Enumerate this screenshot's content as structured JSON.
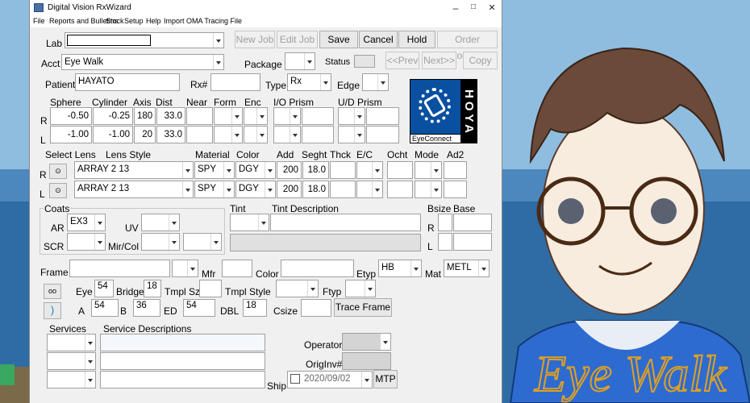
{
  "window": {
    "title": "Digital Vision RxWizard",
    "minimize": "–",
    "maximize": "□",
    "close": "✕"
  },
  "menu": [
    "File",
    "Reports and Bulletins",
    "Stock",
    "Setup",
    "Help",
    "Import OMA Tracing File"
  ],
  "buttons": {
    "new_job": "New Job",
    "edit_job": "Edit Job",
    "save": "Save",
    "cancel": "Cancel",
    "hold": "Hold",
    "order_lookup": "Order Lookup",
    "prev": "<<Prev",
    "next": "Next>>",
    "copy": "Copy",
    "trace_frame": "Trace Frame",
    "mtp": "MTP"
  },
  "labels": {
    "lab": "Lab",
    "acct": "Acct",
    "patient": "Patient",
    "rx_num": "Rx#",
    "type": "Type",
    "edge": "Edge",
    "package": "Package",
    "status": "Status",
    "sphere": "Sphere",
    "cylinder": "Cylinder",
    "axis": "Axis",
    "dist": "Dist",
    "near": "Near",
    "form": "Form",
    "enc": "Enc",
    "io_prism": "I/O Prism",
    "ud_prism": "U/D Prism",
    "r": "R",
    "l": "L",
    "select_lens": "Select Lens",
    "lens_style": "Lens Style",
    "material": "Material",
    "color": "Color",
    "add": "Add",
    "seght": "Seght",
    "thck": "Thck",
    "ec": "E/C",
    "ocht": "Ocht",
    "mode": "Mode",
    "ad2": "Ad2",
    "coats": "Coats",
    "ar": "AR",
    "uv": "UV",
    "scr": "SCR",
    "mir_col": "Mir/Col",
    "tint": "Tint",
    "tint_desc": "Tint Description",
    "bsize": "Bsize",
    "base": "Base",
    "frame": "Frame",
    "mfr": "Mfr",
    "frame_color": "Color",
    "etyp": "Etyp",
    "mat": "Mat",
    "eye": "Eye",
    "bridge": "Bridge",
    "tmpl_sz": "Tmpl Sz",
    "tmpl_style": "Tmpl Style",
    "ftyp": "Ftyp",
    "a": "A",
    "b": "B",
    "ed": "ED",
    "dbl": "DBL",
    "csize": "Csize",
    "services": "Services",
    "service_desc": "Service Descriptions",
    "operator": "Operator",
    "origin_inv": "OrigInv#",
    "ship": "Ship"
  },
  "values": {
    "acct": "Eye Walk",
    "patient": "HAYATO",
    "type": "Rx",
    "r_sphere": "-0.50",
    "r_cyl": "-0.25",
    "r_axis": "180",
    "r_dist": "33.0",
    "l_sphere": "-1.00",
    "l_cyl": "-1.00",
    "l_axis": "20",
    "l_dist": "33.0",
    "r_lens": "ARRAY 2 13",
    "r_material": "SPY",
    "r_color": "DGY",
    "r_add": "200",
    "r_seght": "18.0",
    "l_lens": "ARRAY 2 13",
    "l_material": "SPY",
    "l_color": "DGY",
    "l_add": "200",
    "l_seght": "18.0",
    "ar": "EX3",
    "etyp": "HB",
    "mat": "METL",
    "eye": "54",
    "bridge": "18",
    "a": "54",
    "b": "36",
    "ed": "54",
    "dbl": "18",
    "ship_date": "2020/09/02"
  },
  "logo": {
    "brand": "HOYA",
    "sub": "EyeConnect"
  },
  "illustration": {
    "caption": "Eye Walk"
  },
  "colors": {
    "accent": "#0a50a0",
    "logo_bg": "#0a50a0",
    "window_bg": "#f0f0f0"
  }
}
